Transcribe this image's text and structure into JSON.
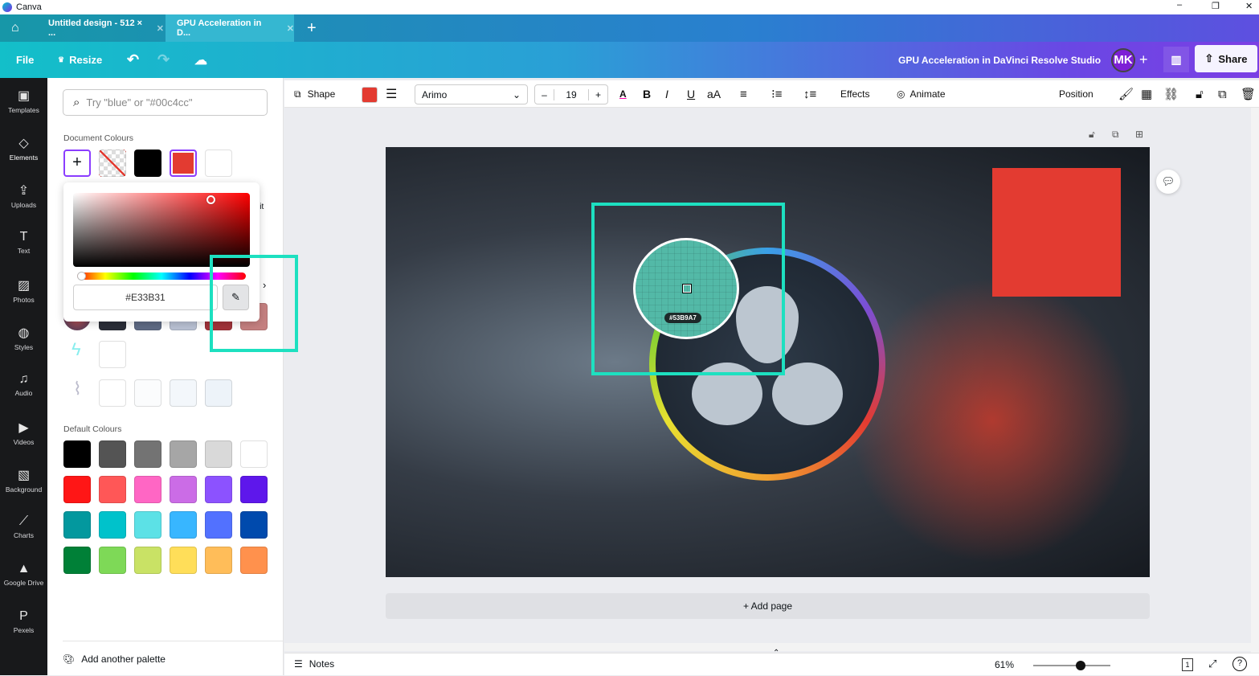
{
  "app_title": "Canva",
  "tabs": [
    {
      "label": "Untitled design - 512 × ..."
    },
    {
      "label": "GPU Acceleration in D..."
    }
  ],
  "header": {
    "file": "File",
    "resize": "Resize",
    "design_title": "GPU Acceleration in DaVinci Resolve Studio",
    "avatar": "MK",
    "share": "Share"
  },
  "rail": [
    "Templates",
    "Elements",
    "Uploads",
    "Text",
    "Photos",
    "Styles",
    "Audio",
    "Videos",
    "Background",
    "Charts",
    "Google Drive",
    "Pexels"
  ],
  "panel": {
    "search_placeholder": "Try \"blue\" or \"#00c4cc\"",
    "document_colours_label": "Document Colours",
    "document_colours": [
      "#000000",
      "#E33B31",
      "#FFFFFF"
    ],
    "photo_colours": [
      "#2b2e38",
      "#5f6b85",
      "#b9c1d3",
      "#a3333a",
      "#c58080"
    ],
    "row3": [
      "#ffffff"
    ],
    "row4": [
      "#ffffff",
      "#fbfcfd",
      "#f3f7fb",
      "#edf3f9"
    ],
    "partial_text": "lit",
    "default_colours_label": "Default Colours",
    "default_colours": [
      [
        "#000000",
        "#545454",
        "#737373",
        "#a6a6a6",
        "#d9d9d9",
        "#ffffff"
      ],
      [
        "#ff1616",
        "#ff5757",
        "#ff66c4",
        "#cb6ce6",
        "#8c52ff",
        "#5e17eb"
      ],
      [
        "#03989e",
        "#00c2cb",
        "#5ce1e6",
        "#38b6ff",
        "#5271ff",
        "#004aad"
      ],
      [
        "#008037",
        "#7ed957",
        "#c9e265",
        "#ffde59",
        "#ffbd59",
        "#ff914d"
      ]
    ],
    "add_palette": "Add another palette"
  },
  "picker": {
    "hex": "#E33B31"
  },
  "toolbar": {
    "shape": "Shape",
    "fill_color": "#E33B31",
    "font": "Arimo",
    "font_size": "19",
    "effects": "Effects",
    "animate": "Animate",
    "position": "Position"
  },
  "eyedropper": {
    "hex": "#53B9A7"
  },
  "canvas": {
    "add_page": "+ Add page"
  },
  "bottom": {
    "notes": "Notes",
    "zoom": "61%",
    "page": "1",
    "zoom_fraction": 0.61
  }
}
